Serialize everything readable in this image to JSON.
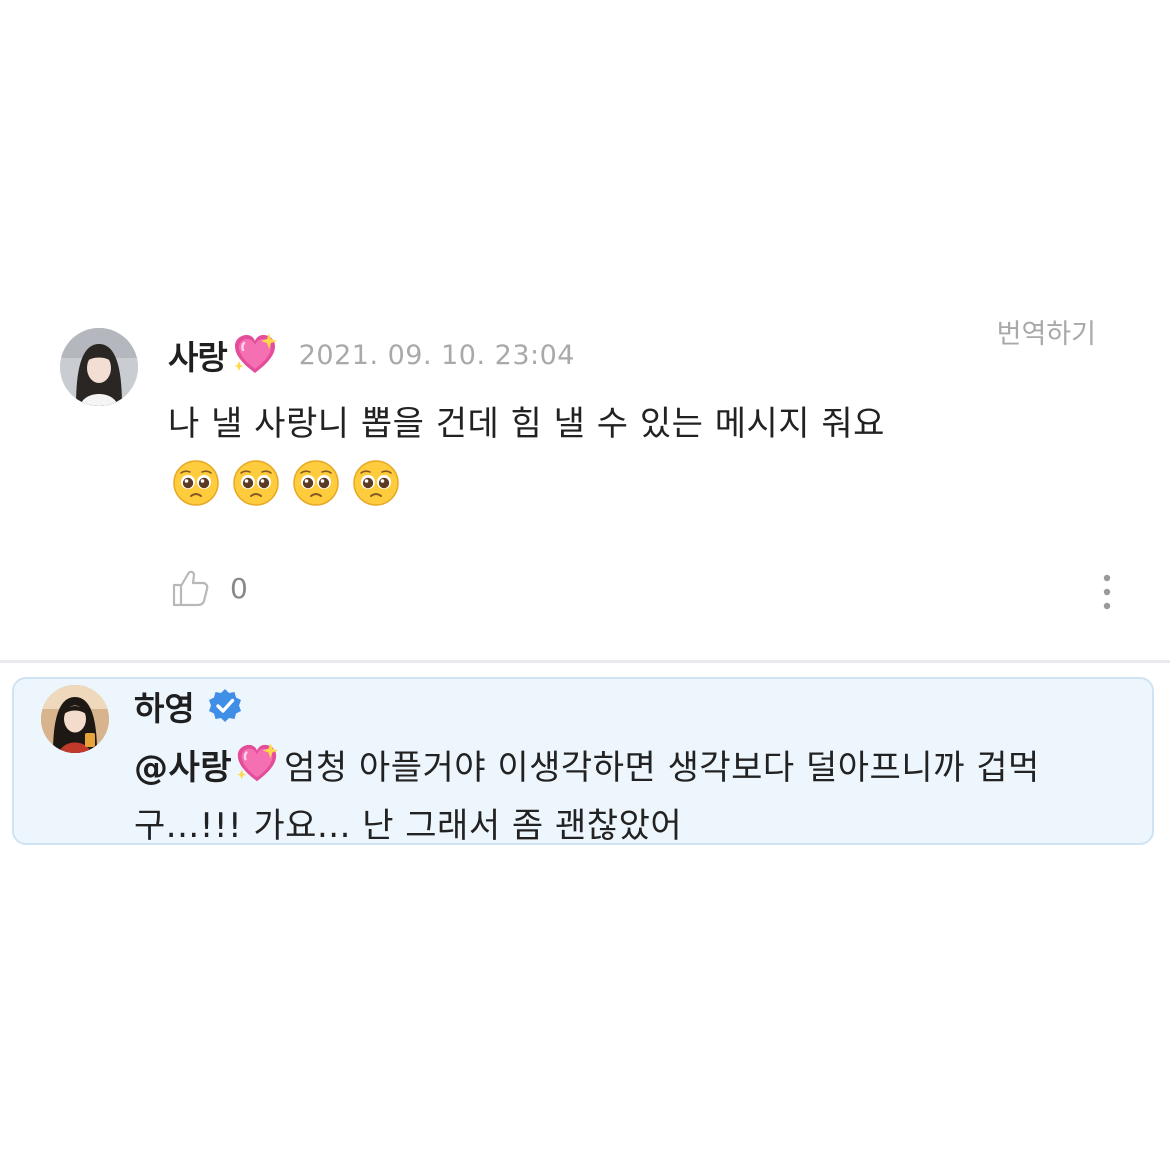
{
  "comment": {
    "author": "사랑",
    "author_emoji": "sparkling-heart",
    "timestamp": "2021. 09. 10. 23:04",
    "translate_label": "번역하기",
    "body": "나 낼 사랑니 뽑을 건데 힘 낼 수 있는 메시지 줘요",
    "trailing_emoji": [
      "pleading-face",
      "pleading-face",
      "pleading-face",
      "pleading-face"
    ],
    "like_count": "0"
  },
  "reply": {
    "author": "하영",
    "verified": true,
    "mention": "@사랑",
    "mention_emoji": "sparkling-heart",
    "body": "엄청 아플거야 이생각하면 생각보다 덜아프니까 겁먹구...!!! 가요... 난 그래서 좀 괜찮았어"
  },
  "colors": {
    "reply_background": "#eef6fd",
    "reply_border": "#cfe3f4",
    "verified_badge": "#3f8fe6",
    "muted_text": "#a9a9a9"
  }
}
